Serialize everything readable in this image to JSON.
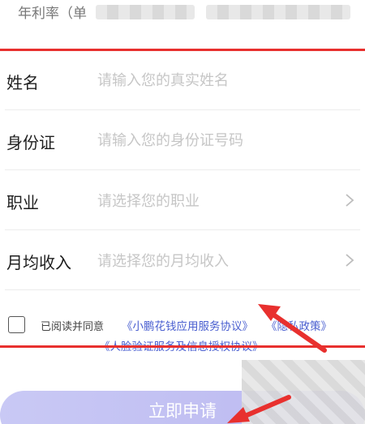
{
  "rate": {
    "label": "年利率（单"
  },
  "form": {
    "name": {
      "label": "姓名",
      "placeholder": "请输入您的真实姓名"
    },
    "id_card": {
      "label": "身份证",
      "placeholder": "请输入您的身份证号码"
    },
    "occupation": {
      "label": "职业",
      "placeholder": "请选择您的职业"
    },
    "income": {
      "label": "月均收入",
      "placeholder": "请选择您的月均收入"
    }
  },
  "agreement": {
    "prefix": "已阅读并同意",
    "link_service": "《小鹏花钱应用服务协议》",
    "link_privacy": "《隐私政策》",
    "link_face": "《人脸验证服务及信息授权协议》",
    "checked": false
  },
  "submit": {
    "label": "立即申请"
  },
  "colors": {
    "highlight_red": "#e8302e",
    "link_blue": "#4a5fd0",
    "button_purple": "#c4c2f3",
    "placeholder_gray": "#c6c6c6"
  }
}
